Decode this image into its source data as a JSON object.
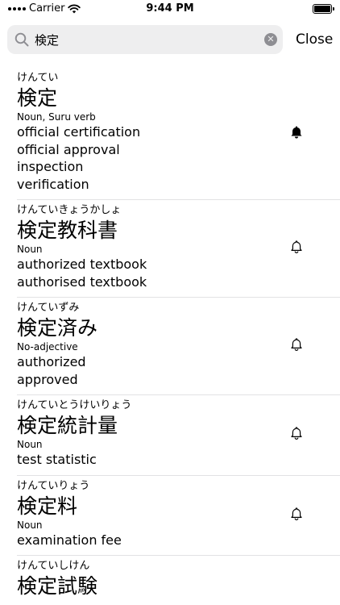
{
  "status": {
    "carrier": "Carrier",
    "time": "9:44 PM"
  },
  "search": {
    "query": "検定",
    "clear_icon": "clear-icon",
    "close_label": "Close"
  },
  "entries": [
    {
      "reading": "けんてい",
      "kanji": "検定",
      "pos": "Noun, Suru verb",
      "glosses": [
        "official certification",
        "official approval",
        "inspection",
        "verification"
      ],
      "bell": "filled"
    },
    {
      "reading": "けんていきょうかしょ",
      "kanji": "検定教科書",
      "pos": "Noun",
      "glosses": [
        "authorized textbook",
        "authorised textbook"
      ],
      "bell": "outline"
    },
    {
      "reading": "けんていずみ",
      "kanji": "検定済み",
      "pos": "No-adjective",
      "glosses": [
        "authorized",
        "approved"
      ],
      "bell": "outline"
    },
    {
      "reading": "けんていとうけいりょう",
      "kanji": "検定統計量",
      "pos": "Noun",
      "glosses": [
        "test statistic"
      ],
      "bell": "outline"
    },
    {
      "reading": "けんていりょう",
      "kanji": "検定料",
      "pos": "Noun",
      "glosses": [
        "examination fee"
      ],
      "bell": "outline"
    },
    {
      "reading": "けんていしけん",
      "kanji": "検定試験",
      "pos": "",
      "glosses": [],
      "bell": ""
    }
  ]
}
